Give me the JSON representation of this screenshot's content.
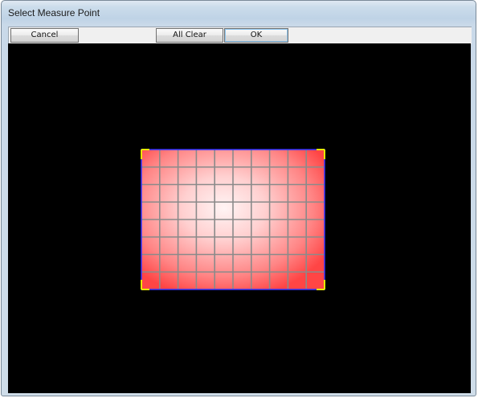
{
  "window": {
    "title": "Select Measure Point"
  },
  "toolbar": {
    "cancel_label": "Cancel",
    "all_clear_label": "All Clear",
    "ok_label": "OK"
  },
  "measurement_view": {
    "grid_columns": 10,
    "grid_rows": 8,
    "colors": {
      "background": "#000000",
      "panel_center": "#fff0f0",
      "panel_edge": "#ff4a4a",
      "grid_line": "#8a8a8a",
      "border_line": "#3333ff",
      "corner_marker": "#e8e800"
    }
  }
}
